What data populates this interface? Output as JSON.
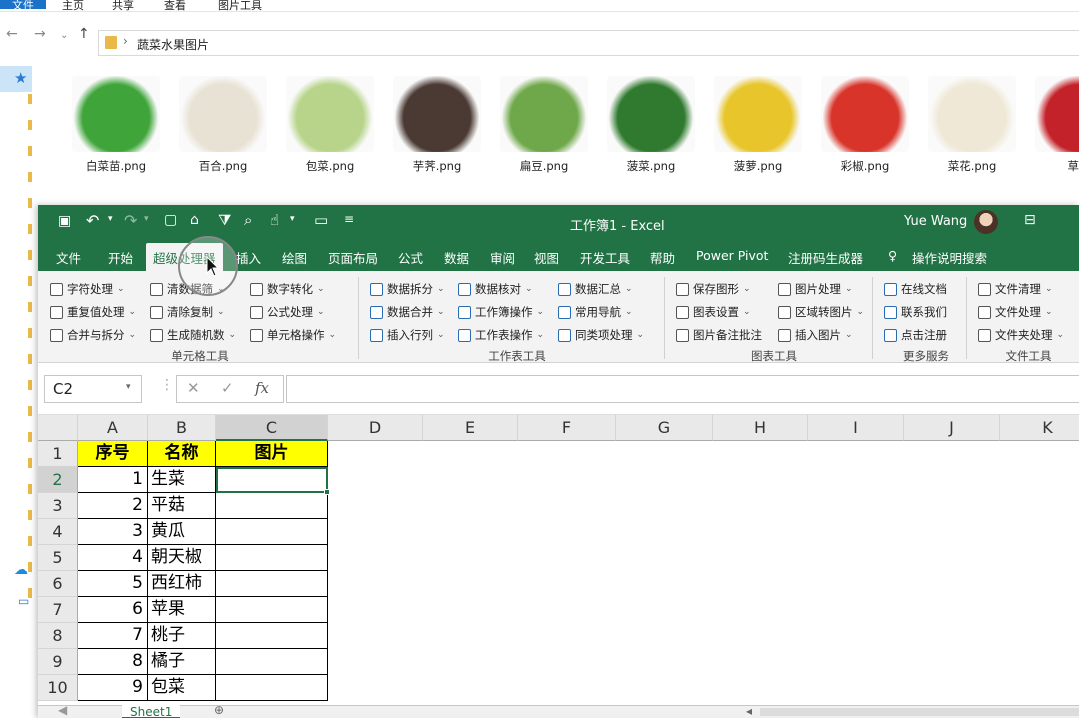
{
  "explorer": {
    "ribbon_tabs": [
      "文件",
      "主页",
      "共享",
      "查看",
      "图片工具"
    ],
    "breadcrumb": "蔬菜水果图片",
    "files": [
      {
        "name": "白菜苗.png",
        "color": "#3fa53a"
      },
      {
        "name": "百合.png",
        "color": "#e8e2d4"
      },
      {
        "name": "包菜.png",
        "color": "#b7d48a"
      },
      {
        "name": "芋荠.png",
        "color": "#4a3a33"
      },
      {
        "name": "扁豆.png",
        "color": "#6fa84a"
      },
      {
        "name": "菠菜.png",
        "color": "#2f7a2e"
      },
      {
        "name": "菠萝.png",
        "color": "#e8c52a"
      },
      {
        "name": "彩椒.png",
        "color": "#d8342a"
      },
      {
        "name": "菜花.png",
        "color": "#efe8d6"
      },
      {
        "name": "草莓",
        "color": "#c4222a"
      }
    ]
  },
  "excel": {
    "title": "工作簿1 - Excel",
    "user": "Yue Wang",
    "tabs": [
      "文件",
      "开始",
      "超级处理器",
      "插入",
      "绘图",
      "页面布局",
      "公式",
      "数据",
      "审阅",
      "视图",
      "开发工具",
      "帮助",
      "Power Pivot",
      "注册码生成器",
      "操作说明搜索"
    ],
    "ribbon": {
      "groups": [
        "单元格工具",
        "工作表工具",
        "图表工具",
        "更多服务",
        "文件工具"
      ],
      "col1": [
        "字符处理",
        "重复值处理",
        "合并与拆分"
      ],
      "col2": [
        "清数据筛",
        "清除复制",
        "生成随机数"
      ],
      "col3": [
        "数字转化",
        "公式处理",
        "单元格操作"
      ],
      "col4": [
        "数据拆分",
        "数据合并",
        "插入行列"
      ],
      "col5": [
        "数据核对",
        "工作簿操作",
        "工作表操作"
      ],
      "col6": [
        "数据汇总",
        "常用导航",
        "同类项处理"
      ],
      "col7": [
        "保存图形",
        "图表设置",
        "图片备注批注"
      ],
      "col8": [
        "图片处理",
        "区域转图片",
        "插入图片"
      ],
      "col9": [
        "在线文档",
        "联系我们",
        "点击注册"
      ],
      "col10": [
        "文件清理",
        "文件处理",
        "文件夹处理"
      ]
    },
    "name_box": "C2",
    "fx": "fx",
    "columns": [
      "A",
      "B",
      "C",
      "D",
      "E",
      "F",
      "G",
      "H",
      "I",
      "J",
      "K"
    ],
    "rows": [
      "1",
      "2",
      "3",
      "4",
      "5",
      "6",
      "7",
      "8",
      "9",
      "10"
    ],
    "table": {
      "headers": [
        "序号",
        "名称",
        "图片"
      ],
      "data": [
        [
          "1",
          "生菜"
        ],
        [
          "2",
          "平菇"
        ],
        [
          "3",
          "黄瓜"
        ],
        [
          "4",
          "朝天椒"
        ],
        [
          "5",
          "西红柿"
        ],
        [
          "6",
          "苹果"
        ],
        [
          "7",
          "桃子"
        ],
        [
          "8",
          "橘子"
        ],
        [
          "9",
          "包菜"
        ]
      ]
    },
    "sheet": "Sheet1"
  }
}
